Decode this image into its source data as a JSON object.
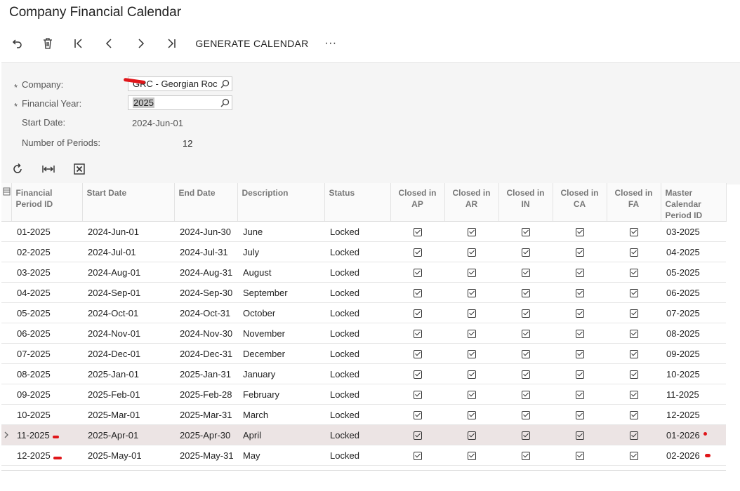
{
  "page": {
    "title": "Company Financial Calendar"
  },
  "toolbar": {
    "generate_label": "GENERATE CALENDAR",
    "more_label": "···"
  },
  "form": {
    "company_label": "Company:",
    "company_value": "GRC - Georgian Roc",
    "year_label": "Financial Year:",
    "year_value": "2025",
    "start_label": "Start Date:",
    "start_value": "2024-Jun-01",
    "periods_label": "Number of Periods:",
    "periods_value": "12",
    "required_mark": "*"
  },
  "grid": {
    "columns": [
      "Financial Period ID",
      "Start Date",
      "End Date",
      "Description",
      "Status",
      "Closed in AP",
      "Closed in AR",
      "Closed in IN",
      "Closed in CA",
      "Closed in FA",
      "Master Calendar Period ID"
    ],
    "rows": [
      {
        "id": "01-2025",
        "start": "2024-Jun-01",
        "end": "2024-Jun-30",
        "desc": "June",
        "status": "Locked",
        "ap": true,
        "ar": true,
        "in": true,
        "ca": true,
        "fa": true,
        "master": "03-2025"
      },
      {
        "id": "02-2025",
        "start": "2024-Jul-01",
        "end": "2024-Jul-31",
        "desc": "July",
        "status": "Locked",
        "ap": true,
        "ar": true,
        "in": true,
        "ca": true,
        "fa": true,
        "master": "04-2025"
      },
      {
        "id": "03-2025",
        "start": "2024-Aug-01",
        "end": "2024-Aug-31",
        "desc": "August",
        "status": "Locked",
        "ap": true,
        "ar": true,
        "in": true,
        "ca": true,
        "fa": true,
        "master": "05-2025"
      },
      {
        "id": "04-2025",
        "start": "2024-Sep-01",
        "end": "2024-Sep-30",
        "desc": "September",
        "status": "Locked",
        "ap": true,
        "ar": true,
        "in": true,
        "ca": true,
        "fa": true,
        "master": "06-2025"
      },
      {
        "id": "05-2025",
        "start": "2024-Oct-01",
        "end": "2024-Oct-31",
        "desc": "October",
        "status": "Locked",
        "ap": true,
        "ar": true,
        "in": true,
        "ca": true,
        "fa": true,
        "master": "07-2025"
      },
      {
        "id": "06-2025",
        "start": "2024-Nov-01",
        "end": "2024-Nov-30",
        "desc": "November",
        "status": "Locked",
        "ap": true,
        "ar": true,
        "in": true,
        "ca": true,
        "fa": true,
        "master": "08-2025"
      },
      {
        "id": "07-2025",
        "start": "2024-Dec-01",
        "end": "2024-Dec-31",
        "desc": "December",
        "status": "Locked",
        "ap": true,
        "ar": true,
        "in": true,
        "ca": true,
        "fa": true,
        "master": "09-2025"
      },
      {
        "id": "08-2025",
        "start": "2025-Jan-01",
        "end": "2025-Jan-31",
        "desc": "January",
        "status": "Locked",
        "ap": true,
        "ar": true,
        "in": true,
        "ca": true,
        "fa": true,
        "master": "10-2025"
      },
      {
        "id": "09-2025",
        "start": "2025-Feb-01",
        "end": "2025-Feb-28",
        "desc": "February",
        "status": "Locked",
        "ap": true,
        "ar": true,
        "in": true,
        "ca": true,
        "fa": true,
        "master": "11-2025"
      },
      {
        "id": "10-2025",
        "start": "2025-Mar-01",
        "end": "2025-Mar-31",
        "desc": "March",
        "status": "Locked",
        "ap": true,
        "ar": true,
        "in": true,
        "ca": true,
        "fa": true,
        "master": "12-2025"
      },
      {
        "id": "11-2025",
        "start": "2025-Apr-01",
        "end": "2025-Apr-30",
        "desc": "April",
        "status": "Locked",
        "ap": true,
        "ar": true,
        "in": true,
        "ca": true,
        "fa": true,
        "master": "01-2026",
        "selected": true
      },
      {
        "id": "12-2025",
        "start": "2025-May-01",
        "end": "2025-May-31",
        "desc": "May",
        "status": "Locked",
        "ap": true,
        "ar": true,
        "in": true,
        "ca": true,
        "fa": true,
        "master": "02-2026"
      }
    ]
  },
  "colors": {
    "selected_row": "#ece4e4",
    "annotation_red": "#e0161a",
    "panel": "#f5f5f5"
  },
  "icons": [
    "undo-icon",
    "trash-icon",
    "first-icon",
    "prev-icon",
    "next-icon",
    "last-icon",
    "refresh-icon",
    "fit-columns-icon",
    "excel-icon",
    "search-icon",
    "row-indicator-icon",
    "column-settings-icon"
  ]
}
